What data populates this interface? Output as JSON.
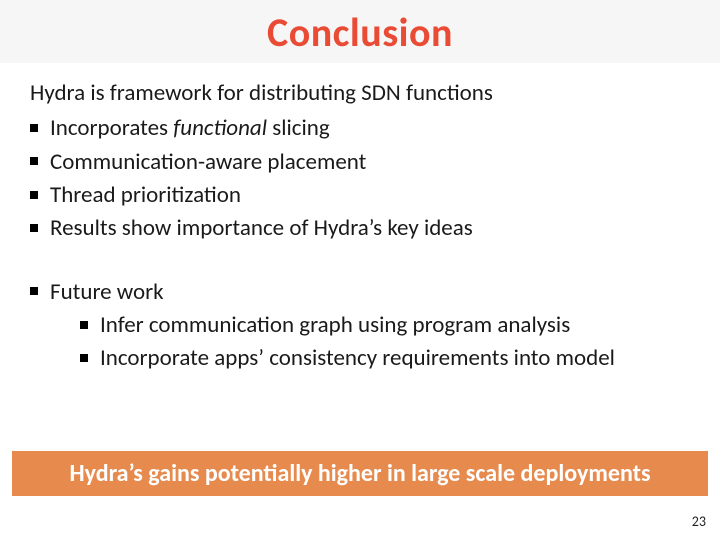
{
  "title": "Conclusion",
  "intro": "Hydra is framework for distributing SDN functions",
  "bullets": {
    "b1_pre": "Incorporates ",
    "b1_em": "functional",
    "b1_post": " slicing",
    "b2": "Communication-aware placement",
    "b3": "Thread prioritization",
    "b4": "Results show importance of Hydra’s key ideas"
  },
  "future": {
    "label": "Future work",
    "s1": "Infer communication graph using program analysis",
    "s2": "Incorporate apps’ consistency requirements into model"
  },
  "callout": "Hydra’s gains potentially higher in large scale deployments",
  "page_number": "23"
}
